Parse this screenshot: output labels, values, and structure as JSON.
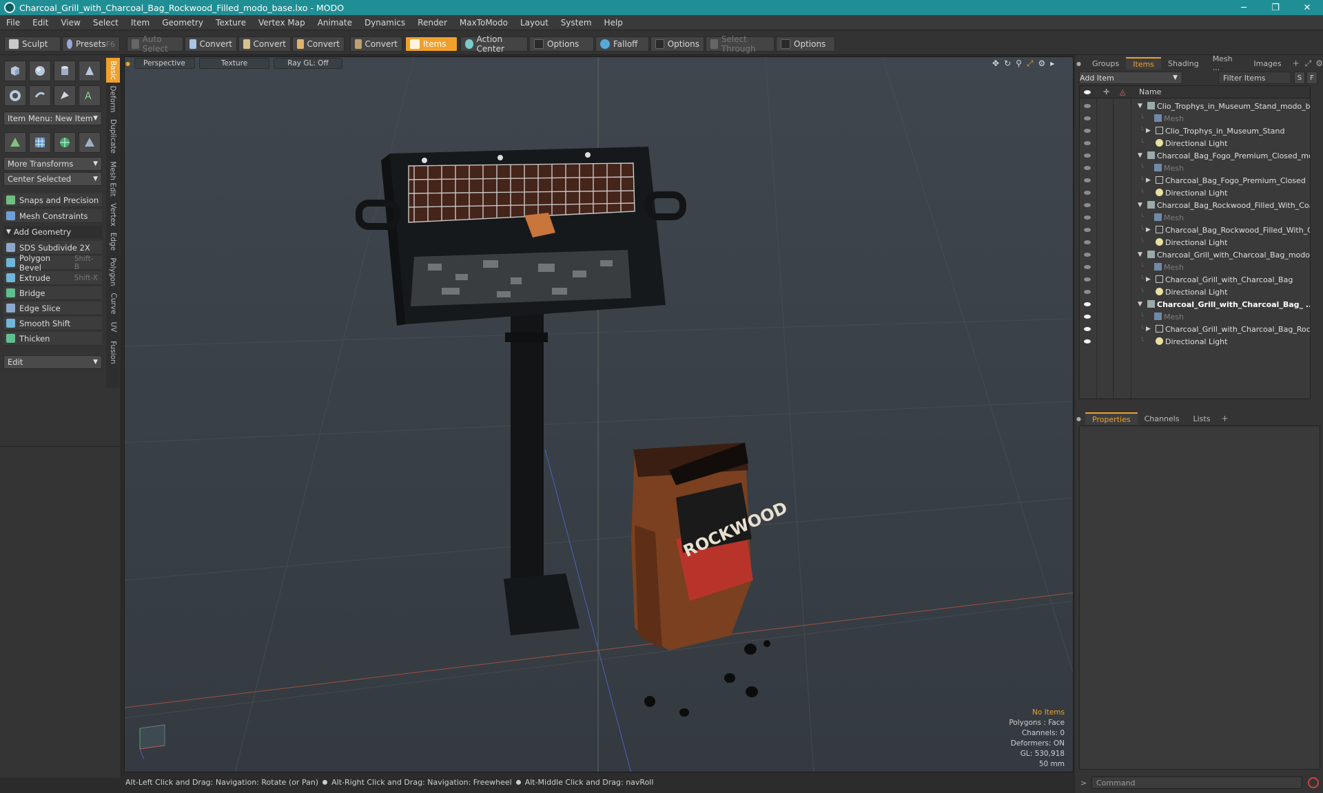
{
  "window": {
    "title": "Charcoal_Grill_with_Charcoal_Bag_Rockwood_Filled_modo_base.lxo - MODO",
    "min_glyph": "─",
    "max_glyph": "❐",
    "close_glyph": "✕"
  },
  "menu": [
    "File",
    "Edit",
    "View",
    "Select",
    "Item",
    "Geometry",
    "Texture",
    "Vertex Map",
    "Animate",
    "Dynamics",
    "Render",
    "MaxToModo",
    "Layout",
    "System",
    "Help"
  ],
  "toolbar": {
    "sculpt": "Sculpt",
    "presets": "Presets",
    "presets_key": "F6",
    "auto_select": "Auto Select",
    "convert1": "Convert",
    "convert2": "Convert",
    "convert3": "Convert",
    "convert4": "Convert",
    "items": "Items",
    "action_center": "Action Center",
    "options1": "Options",
    "falloff": "Falloff",
    "options2": "Options",
    "select_through": "Select Through",
    "options3": "Options"
  },
  "left_tabs": [
    "Basic",
    "Deform",
    "Duplicate",
    "Mesh Edit",
    "Vertex",
    "Edge",
    "Polygon",
    "Curve",
    "UV",
    "Fusion"
  ],
  "left": {
    "item_menu": "Item Menu: New Item",
    "more_transforms": "More Transforms",
    "center_selected": "Center Selected",
    "snaps": "Snaps and Precision",
    "mesh_constraints": "Mesh Constraints",
    "add_geometry": "Add Geometry",
    "tools": [
      {
        "label": "SDS Subdivide 2X",
        "shortcut": ""
      },
      {
        "label": "Polygon Bevel",
        "shortcut": "Shift-B"
      },
      {
        "label": "Extrude",
        "shortcut": "Shift-X"
      },
      {
        "label": "Bridge",
        "shortcut": ""
      },
      {
        "label": "Edge Slice",
        "shortcut": ""
      },
      {
        "label": "Smooth Shift",
        "shortcut": ""
      },
      {
        "label": "Thicken",
        "shortcut": ""
      }
    ],
    "edit": "Edit"
  },
  "viewport": {
    "view": "Perspective",
    "shading": "Texture",
    "raygl": "Ray GL: Off",
    "bag_text": "ROCKWOOD",
    "hud": {
      "no_items": "No Items",
      "polygons": "Polygons : Face",
      "channels": "Channels: 0",
      "deformers": "Deformers: ON",
      "gl": "GL: 530,918",
      "focal": "50 mm"
    }
  },
  "status": {
    "hint1": "Alt-Left Click and Drag: Navigation: Rotate (or Pan)",
    "hint2": "Alt-Right Click and Drag: Navigation: Freewheel",
    "hint3": "Alt-Middle Click and Drag: navRoll"
  },
  "right": {
    "tabs": [
      "Groups",
      "Items",
      "Shading",
      "Mesh ...",
      "Images"
    ],
    "add_item": "Add Item",
    "filter_items": "Filter Items",
    "filter_s": "S",
    "filter_f": "F",
    "name_header": "Name",
    "tree": [
      {
        "label": "Clio_Trophys_in_Museum_Stand_modo_ba ...",
        "kind": "scene",
        "eye": "off"
      },
      {
        "label": "Mesh",
        "kind": "mesh",
        "eye": "off"
      },
      {
        "label": "Clio_Trophys_in_Museum_Stand",
        "kind": "group",
        "eye": "off"
      },
      {
        "label": "Directional Light",
        "kind": "light",
        "eye": "off"
      },
      {
        "label": "Charcoal_Bag_Fogo_Premium_Closed_mod...",
        "kind": "scene",
        "eye": "off"
      },
      {
        "label": "Mesh",
        "kind": "mesh",
        "eye": "off"
      },
      {
        "label": "Charcoal_Bag_Fogo_Premium_Closed",
        "kind": "group",
        "eye": "off"
      },
      {
        "label": "Directional Light",
        "kind": "light",
        "eye": "off"
      },
      {
        "label": "Charcoal_Bag_Rockwood_Filled_With_Coal...",
        "kind": "scene",
        "eye": "off"
      },
      {
        "label": "Mesh",
        "kind": "mesh",
        "eye": "off"
      },
      {
        "label": "Charcoal_Bag_Rockwood_Filled_With_Coal",
        "kind": "group",
        "eye": "off"
      },
      {
        "label": "Directional Light",
        "kind": "light",
        "eye": "off"
      },
      {
        "label": "Charcoal_Grill_with_Charcoal_Bag_modo-b ...",
        "kind": "scene",
        "eye": "off"
      },
      {
        "label": "Mesh",
        "kind": "mesh",
        "eye": "off"
      },
      {
        "label": "Charcoal_Grill_with_Charcoal_Bag",
        "kind": "group",
        "eye": "off"
      },
      {
        "label": "Directional Light",
        "kind": "light",
        "eye": "off"
      },
      {
        "label": "Charcoal_Grill_with_Charcoal_Bag_ ...",
        "kind": "scene-bold",
        "eye": "on"
      },
      {
        "label": "Mesh",
        "kind": "mesh",
        "eye": "on"
      },
      {
        "label": "Charcoal_Grill_with_Charcoal_Bag_Rock ...",
        "kind": "group",
        "eye": "on"
      },
      {
        "label": "Directional Light",
        "kind": "light",
        "eye": "on"
      }
    ],
    "prop_tabs": [
      "Properties",
      "Channels",
      "Lists"
    ],
    "command": "Command"
  },
  "colors": {
    "accent": "#f0a02a",
    "titlebar": "#1f8f95"
  }
}
